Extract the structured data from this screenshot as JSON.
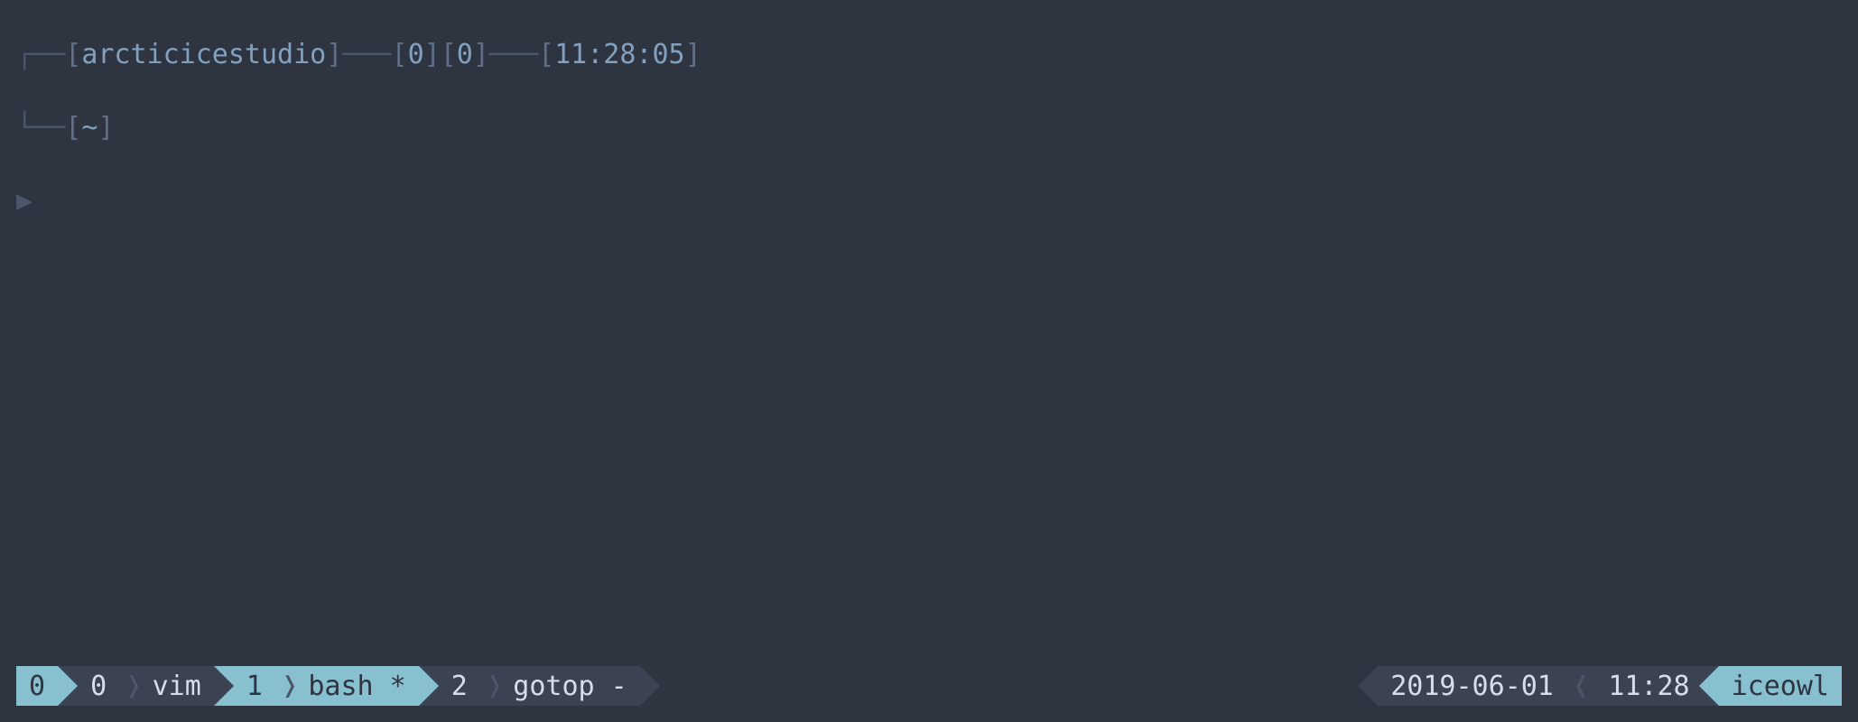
{
  "prompt": {
    "top_left_corner": "┌──",
    "bracket_open": "[",
    "bracket_close": "]",
    "user": "arcticicestudio",
    "connector1": "───",
    "status1": "0",
    "status2": "0",
    "connector2": "───",
    "time": "11:28:05",
    "bottom_left_corner": "└──",
    "cwd": "~",
    "caret": "▶"
  },
  "statusbar": {
    "left": {
      "session": "0",
      "windows": [
        {
          "index": "0",
          "name": "vim",
          "flag": ""
        },
        {
          "index": "1",
          "name": "bash",
          "flag": "*"
        },
        {
          "index": "2",
          "name": "gotop",
          "flag": "-"
        }
      ]
    },
    "right": {
      "date": "2019-06-01",
      "time": "11:28",
      "host": "iceowl"
    }
  }
}
